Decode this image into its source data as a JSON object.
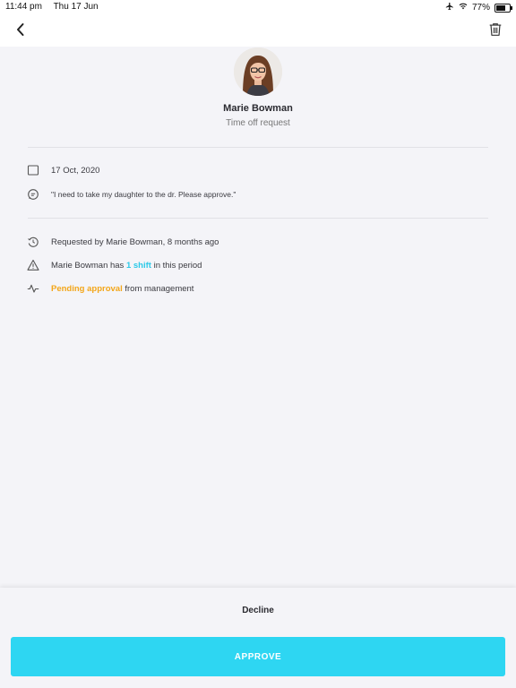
{
  "status_bar": {
    "time": "11:44 pm",
    "date": "Thu 17 Jun",
    "battery": "77%",
    "battery_level": 0.77
  },
  "header": {
    "back_icon": "chevron-left-icon",
    "delete_icon": "trash-icon"
  },
  "profile": {
    "name": "Marie Bowman",
    "subtitle": "Time off request"
  },
  "details": {
    "date": "17 Oct, 2020",
    "comment": "\"I need to take my daughter to the dr.  Please approve.\""
  },
  "info": {
    "requested_by": "Requested by Marie Bowman, 8 months ago",
    "shift_prefix": "Marie Bowman has ",
    "shift_highlight": "1 shift",
    "shift_suffix": " in this period",
    "status_highlight": "Pending approval",
    "status_suffix": " from management"
  },
  "actions": {
    "decline_label": "Decline",
    "approve_label": "APPROVE"
  },
  "colors": {
    "accent": "#2ed6f2",
    "highlight_blue": "#2cc9e8",
    "pending_orange": "#f3a619",
    "background": "#f4f4f8"
  }
}
